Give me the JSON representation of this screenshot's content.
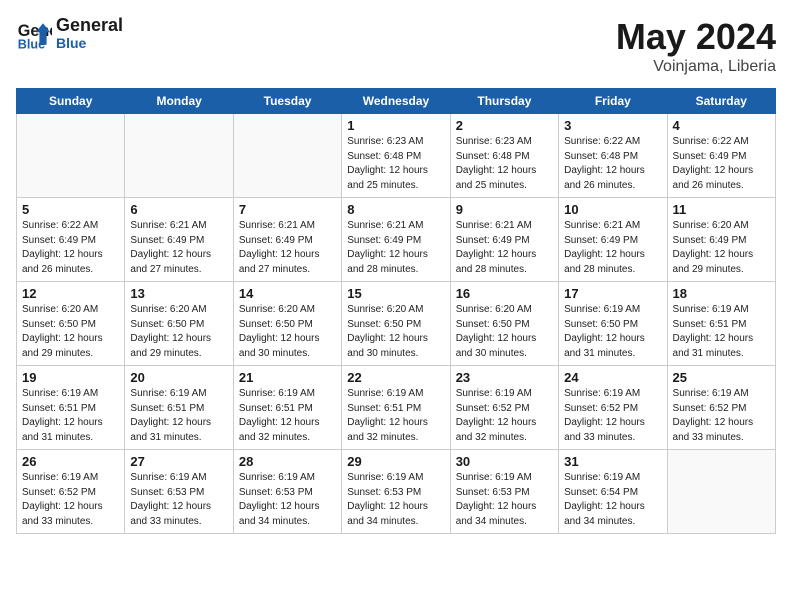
{
  "header": {
    "logo_line1": "General",
    "logo_line2": "Blue",
    "month": "May 2024",
    "location": "Voinjama, Liberia"
  },
  "days_of_week": [
    "Sunday",
    "Monday",
    "Tuesday",
    "Wednesday",
    "Thursday",
    "Friday",
    "Saturday"
  ],
  "weeks": [
    [
      {
        "num": "",
        "info": ""
      },
      {
        "num": "",
        "info": ""
      },
      {
        "num": "",
        "info": ""
      },
      {
        "num": "1",
        "info": "Sunrise: 6:23 AM\nSunset: 6:48 PM\nDaylight: 12 hours\nand 25 minutes."
      },
      {
        "num": "2",
        "info": "Sunrise: 6:23 AM\nSunset: 6:48 PM\nDaylight: 12 hours\nand 25 minutes."
      },
      {
        "num": "3",
        "info": "Sunrise: 6:22 AM\nSunset: 6:48 PM\nDaylight: 12 hours\nand 26 minutes."
      },
      {
        "num": "4",
        "info": "Sunrise: 6:22 AM\nSunset: 6:49 PM\nDaylight: 12 hours\nand 26 minutes."
      }
    ],
    [
      {
        "num": "5",
        "info": "Sunrise: 6:22 AM\nSunset: 6:49 PM\nDaylight: 12 hours\nand 26 minutes."
      },
      {
        "num": "6",
        "info": "Sunrise: 6:21 AM\nSunset: 6:49 PM\nDaylight: 12 hours\nand 27 minutes."
      },
      {
        "num": "7",
        "info": "Sunrise: 6:21 AM\nSunset: 6:49 PM\nDaylight: 12 hours\nand 27 minutes."
      },
      {
        "num": "8",
        "info": "Sunrise: 6:21 AM\nSunset: 6:49 PM\nDaylight: 12 hours\nand 28 minutes."
      },
      {
        "num": "9",
        "info": "Sunrise: 6:21 AM\nSunset: 6:49 PM\nDaylight: 12 hours\nand 28 minutes."
      },
      {
        "num": "10",
        "info": "Sunrise: 6:21 AM\nSunset: 6:49 PM\nDaylight: 12 hours\nand 28 minutes."
      },
      {
        "num": "11",
        "info": "Sunrise: 6:20 AM\nSunset: 6:49 PM\nDaylight: 12 hours\nand 29 minutes."
      }
    ],
    [
      {
        "num": "12",
        "info": "Sunrise: 6:20 AM\nSunset: 6:50 PM\nDaylight: 12 hours\nand 29 minutes."
      },
      {
        "num": "13",
        "info": "Sunrise: 6:20 AM\nSunset: 6:50 PM\nDaylight: 12 hours\nand 29 minutes."
      },
      {
        "num": "14",
        "info": "Sunrise: 6:20 AM\nSunset: 6:50 PM\nDaylight: 12 hours\nand 30 minutes."
      },
      {
        "num": "15",
        "info": "Sunrise: 6:20 AM\nSunset: 6:50 PM\nDaylight: 12 hours\nand 30 minutes."
      },
      {
        "num": "16",
        "info": "Sunrise: 6:20 AM\nSunset: 6:50 PM\nDaylight: 12 hours\nand 30 minutes."
      },
      {
        "num": "17",
        "info": "Sunrise: 6:19 AM\nSunset: 6:50 PM\nDaylight: 12 hours\nand 31 minutes."
      },
      {
        "num": "18",
        "info": "Sunrise: 6:19 AM\nSunset: 6:51 PM\nDaylight: 12 hours\nand 31 minutes."
      }
    ],
    [
      {
        "num": "19",
        "info": "Sunrise: 6:19 AM\nSunset: 6:51 PM\nDaylight: 12 hours\nand 31 minutes."
      },
      {
        "num": "20",
        "info": "Sunrise: 6:19 AM\nSunset: 6:51 PM\nDaylight: 12 hours\nand 31 minutes."
      },
      {
        "num": "21",
        "info": "Sunrise: 6:19 AM\nSunset: 6:51 PM\nDaylight: 12 hours\nand 32 minutes."
      },
      {
        "num": "22",
        "info": "Sunrise: 6:19 AM\nSunset: 6:51 PM\nDaylight: 12 hours\nand 32 minutes."
      },
      {
        "num": "23",
        "info": "Sunrise: 6:19 AM\nSunset: 6:52 PM\nDaylight: 12 hours\nand 32 minutes."
      },
      {
        "num": "24",
        "info": "Sunrise: 6:19 AM\nSunset: 6:52 PM\nDaylight: 12 hours\nand 33 minutes."
      },
      {
        "num": "25",
        "info": "Sunrise: 6:19 AM\nSunset: 6:52 PM\nDaylight: 12 hours\nand 33 minutes."
      }
    ],
    [
      {
        "num": "26",
        "info": "Sunrise: 6:19 AM\nSunset: 6:52 PM\nDaylight: 12 hours\nand 33 minutes."
      },
      {
        "num": "27",
        "info": "Sunrise: 6:19 AM\nSunset: 6:53 PM\nDaylight: 12 hours\nand 33 minutes."
      },
      {
        "num": "28",
        "info": "Sunrise: 6:19 AM\nSunset: 6:53 PM\nDaylight: 12 hours\nand 34 minutes."
      },
      {
        "num": "29",
        "info": "Sunrise: 6:19 AM\nSunset: 6:53 PM\nDaylight: 12 hours\nand 34 minutes."
      },
      {
        "num": "30",
        "info": "Sunrise: 6:19 AM\nSunset: 6:53 PM\nDaylight: 12 hours\nand 34 minutes."
      },
      {
        "num": "31",
        "info": "Sunrise: 6:19 AM\nSunset: 6:54 PM\nDaylight: 12 hours\nand 34 minutes."
      },
      {
        "num": "",
        "info": ""
      }
    ]
  ]
}
